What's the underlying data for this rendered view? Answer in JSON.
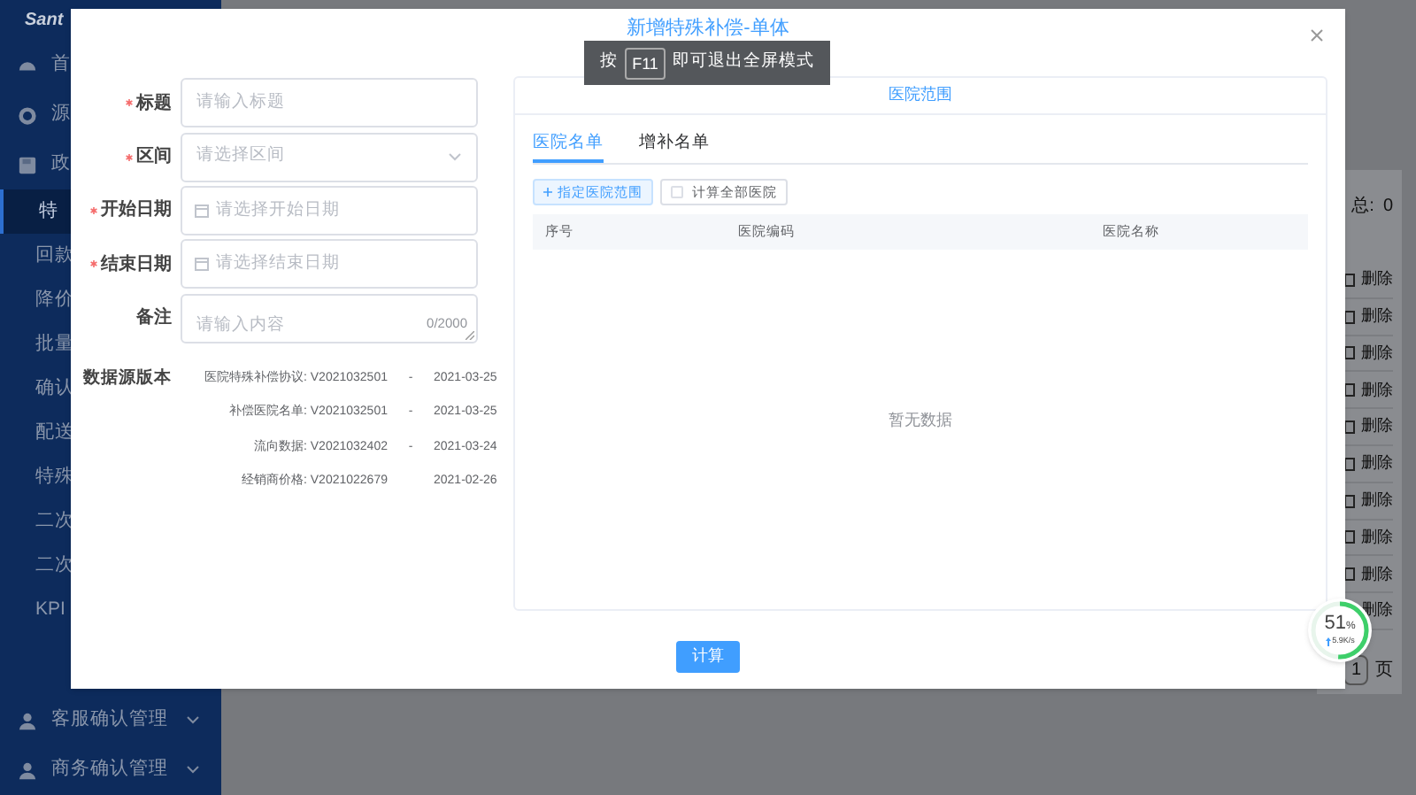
{
  "sidebar": {
    "logo": "Sant",
    "items": [
      {
        "label": "首",
        "kind": "group",
        "selected": false
      },
      {
        "label": "源",
        "kind": "group",
        "selected": false
      },
      {
        "label": "政",
        "kind": "group",
        "selected": false
      },
      {
        "label": "特",
        "kind": "sub",
        "selected": true
      },
      {
        "label": "回款",
        "kind": "sub",
        "selected": false
      },
      {
        "label": "降价",
        "kind": "sub",
        "selected": false
      },
      {
        "label": "批量",
        "kind": "sub",
        "selected": false
      },
      {
        "label": "确认",
        "kind": "sub",
        "selected": false
      },
      {
        "label": "配送",
        "kind": "sub",
        "selected": false
      },
      {
        "label": "特殊",
        "kind": "sub",
        "selected": false
      },
      {
        "label": "二次",
        "kind": "sub",
        "selected": false
      },
      {
        "label": "二次",
        "kind": "sub",
        "selected": false
      },
      {
        "label": "KPI",
        "kind": "sub",
        "selected": false
      },
      {
        "label": "客服确认管理",
        "kind": "group",
        "selected": false,
        "expanded": false
      },
      {
        "label": "商务确认管理",
        "kind": "group",
        "selected": false,
        "expanded": false
      }
    ]
  },
  "background": {
    "summary_label": "总:",
    "summary_value": "0",
    "rows": [
      {
        "action": "删除"
      },
      {
        "action": "删除"
      },
      {
        "action": "删除"
      },
      {
        "action": "删除"
      },
      {
        "action": "删除"
      },
      {
        "action": "删除"
      },
      {
        "action": "删除"
      },
      {
        "action": "删除"
      },
      {
        "action": "删除"
      },
      {
        "action": "删除"
      }
    ],
    "page": "1",
    "page_suffix": "页"
  },
  "dialog": {
    "title": "新增特殊补偿-单体",
    "fields": [
      {
        "label": "标题",
        "required": true,
        "kind": "input",
        "placeholder": "请输入标题"
      },
      {
        "label": "区间",
        "required": true,
        "kind": "select",
        "placeholder": "请选择区间"
      },
      {
        "label": "开始日期",
        "required": true,
        "kind": "date",
        "placeholder": "请选择开始日期"
      },
      {
        "label": "结束日期",
        "required": true,
        "kind": "date",
        "placeholder": "请选择结束日期"
      },
      {
        "label": "备注",
        "required": false,
        "kind": "textarea",
        "placeholder": "请输入内容",
        "counter": "0/2000"
      }
    ],
    "data_sources": {
      "label": "数据源版本",
      "entries": [
        {
          "name": "医院特殊补偿协议: V2021032501",
          "separator": "-",
          "date": "2021-03-25"
        },
        {
          "name": "补偿医院名单: V2021032501",
          "separator": "-",
          "date": "2021-03-25"
        },
        {
          "name": "流向数据: V2021032402",
          "separator": "-",
          "date": "2021-03-24"
        },
        {
          "name": "经销商价格: V2021022679",
          "date": "2021-02-26"
        }
      ]
    },
    "panel": {
      "header": "医院范围",
      "tabs": [
        {
          "label": "医院名单",
          "selected": true
        },
        {
          "label": "增补名单",
          "selected": false
        }
      ],
      "add_button": "指定医院范围",
      "checkbox": {
        "label": "计算全部医院",
        "checked": false
      },
      "columns": [
        "序号",
        "医院编码",
        "医院名称"
      ],
      "empty_text": "暂无数据"
    },
    "submit": "计算"
  },
  "toast": {
    "prefix": "按",
    "key": "F11",
    "suffix": "即可退出全屏模式"
  },
  "speed_widget": {
    "percent": "51",
    "unit": "%",
    "speed": "5.9K/s",
    "level": 0.51
  }
}
